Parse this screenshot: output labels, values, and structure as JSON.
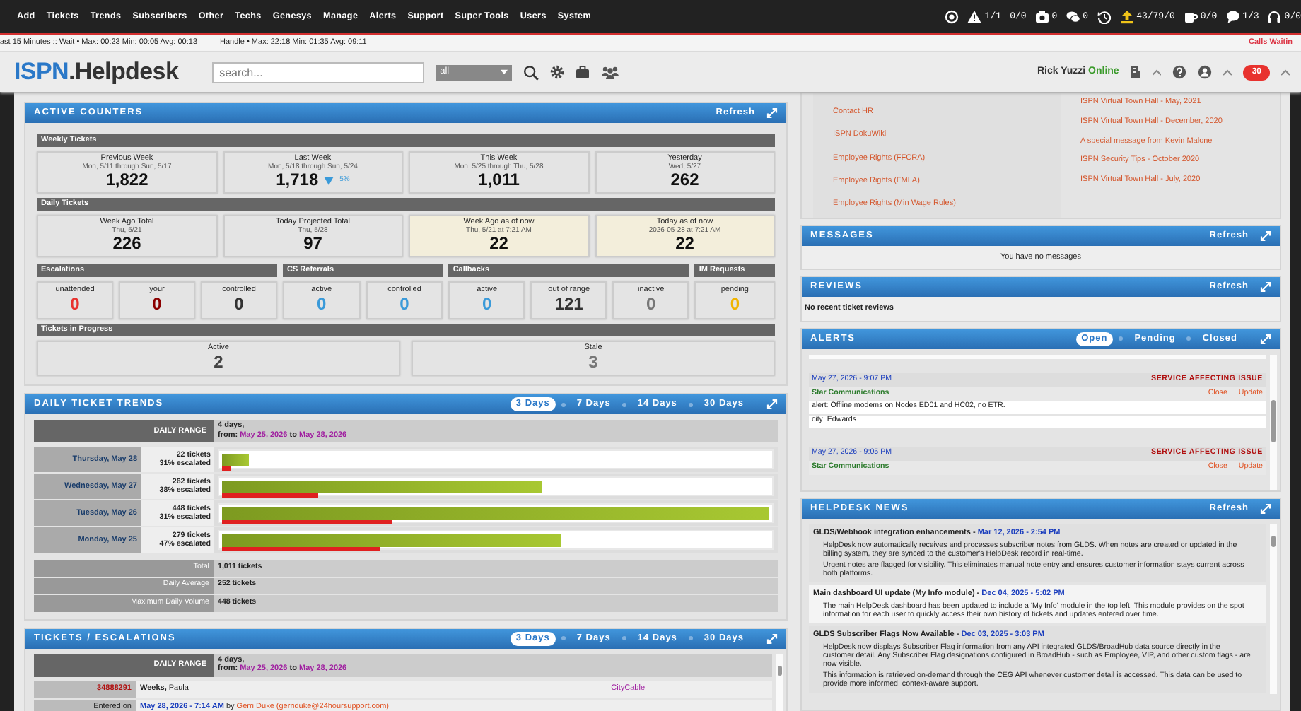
{
  "nav": {
    "menu": [
      "Add",
      "Tickets",
      "Trends",
      "Subscribers",
      "Other",
      "Techs",
      "Genesys",
      "Manage",
      "Alerts",
      "Support",
      "Super Tools",
      "Users",
      "System"
    ],
    "status": [
      {
        "kind": "target"
      },
      {
        "kind": "warning",
        "text": "1/1"
      },
      {
        "kind": "plain",
        "text": "0/0"
      },
      {
        "kind": "camera",
        "text": "0"
      },
      {
        "kind": "chat",
        "text": "0"
      },
      {
        "kind": "history"
      },
      {
        "kind": "upload",
        "text": "43/79/0"
      },
      {
        "kind": "mug",
        "text": "0/0"
      },
      {
        "kind": "comment",
        "text": "1/3"
      },
      {
        "kind": "headset",
        "text": "0/0"
      }
    ]
  },
  "stats_bar": {
    "text": "ast 15 Minutes :: Wait • Max: 00:23 Min: 00:05 Avg: 00:13",
    "handle": "Handle • Max: 22:18 Min: 01:35 Avg: 09:11",
    "right": "Calls Waitin"
  },
  "header": {
    "brand": "ISPN",
    "product": ".Helpdesk",
    "search": {
      "placeholder": "search..."
    },
    "scope": "all",
    "user": "Rick Yuzzi",
    "presence": "Online",
    "notifications": "30"
  },
  "active_counters": {
    "title": "ACTIVE COUNTERS",
    "refresh": "Refresh",
    "weekly": {
      "title": "Weekly Tickets",
      "boxes": [
        {
          "label": "Previous Week",
          "sub": "Mon, 5/11 through Sun, 5/17",
          "value": "1,822",
          "highlighted": false
        },
        {
          "label": "Last Week",
          "sub": "Mon, 5/18 through Sun, 5/24",
          "value": "1,718",
          "highlighted": false,
          "trend": {
            "down": true,
            "text": "5%"
          }
        },
        {
          "label": "This Week",
          "sub": "Mon, 5/25 through Thu, 5/28",
          "value": "1,011",
          "highlighted": false
        },
        {
          "label": "Yesterday",
          "sub": "Wed, 5/27",
          "value": "262",
          "highlighted": false
        }
      ]
    },
    "daily": {
      "title": "Daily Tickets",
      "boxes": [
        {
          "label": "Week Ago Total",
          "sub": "Thu, 5/21",
          "value": "226",
          "highlighted": false
        },
        {
          "label": "Today Projected Total",
          "sub": "Thu, 5/28",
          "value": "97",
          "highlighted": false
        },
        {
          "label": "Week Ago as of now",
          "sub": "Thu, 5/21 at 7:21 AM",
          "value": "22",
          "highlighted": true
        },
        {
          "label": "Today as of now",
          "sub": "2026-05-28 at 7:21 AM",
          "value": "22",
          "highlighted": true
        }
      ]
    },
    "groups": [
      {
        "title": "Escalations",
        "boxes": [
          {
            "label": "unattended",
            "value": "0",
            "color": "#e8322e"
          },
          {
            "label": "your",
            "value": "0",
            "color": "#8b0000"
          },
          {
            "label": "controlled",
            "value": "0",
            "color": "#333333"
          }
        ]
      },
      {
        "title": "CS Referrals",
        "boxes": [
          {
            "label": "active",
            "value": "0",
            "color": "#3a9ad9"
          },
          {
            "label": "controlled",
            "value": "0",
            "color": "#3a9ad9"
          }
        ]
      },
      {
        "title": "Callbacks",
        "boxes": [
          {
            "label": "active",
            "value": "0",
            "color": "#3a9ad9"
          },
          {
            "label": "out of range",
            "value": "121",
            "color": "#333333"
          },
          {
            "label": "inactive",
            "value": "0",
            "color": "#777777"
          }
        ]
      },
      {
        "title": "IM Requests",
        "boxes": [
          {
            "label": "pending",
            "value": "0",
            "color": "#f0b400"
          }
        ]
      }
    ],
    "progress": {
      "title": "Tickets in Progress",
      "boxes": [
        {
          "label": "Active",
          "value": "2",
          "color": "#444444"
        },
        {
          "label": "Stale",
          "value": "3",
          "color": "#777777"
        }
      ]
    }
  },
  "daily_trends": {
    "title": "DAILY TICKET TRENDS",
    "tabs": [
      {
        "label": "3 Days",
        "selected": true
      },
      {
        "label": "7 Days",
        "selected": false
      },
      {
        "label": "14 Days",
        "selected": false
      },
      {
        "label": "30 Days",
        "selected": false
      }
    ],
    "range": {
      "label": "DAILY RANGE",
      "span": "4 days,",
      "from_label": "from:",
      "start": "May 25, 2026",
      "joiner": "to",
      "end": "May 28, 2026"
    },
    "days": [
      {
        "day": "Thursday, May 28",
        "tickets": "22 tickets",
        "escalated": "31% escalated",
        "level": 0.048,
        "escalation": {
          "level": 0.015
        }
      },
      {
        "day": "Wednesday, May 27",
        "tickets": "262 tickets",
        "escalated": "38% escalated",
        "level": 0.585,
        "escalation": {
          "level": 0.176
        }
      },
      {
        "day": "Tuesday, May 26",
        "tickets": "448 tickets",
        "escalated": "31% escalated",
        "level": 1.0,
        "escalation": {
          "level": 0.31
        }
      },
      {
        "day": "Monday, May 25",
        "tickets": "279 tickets",
        "escalated": "47% escalated",
        "level": 0.62,
        "escalation": {
          "level": 0.29
        }
      }
    ],
    "totals": [
      {
        "label": "Total",
        "value": "1,011 tickets"
      },
      {
        "label": "Daily Average",
        "value": "252 tickets"
      },
      {
        "label": "Maximum Daily Volume",
        "value": "448 tickets"
      }
    ]
  },
  "tickets": {
    "title": "TICKETS / ESCALATIONS",
    "tabs": [
      {
        "label": "3 Days",
        "selected": true
      },
      {
        "label": "7 Days",
        "selected": false
      },
      {
        "label": "14 Days",
        "selected": false
      },
      {
        "label": "30 Days",
        "selected": false
      }
    ],
    "range": {
      "label": "DAILY RANGE",
      "span": "4 days,",
      "from_label": "from:",
      "start": "May 25, 2026",
      "joiner": "to",
      "end": "May 28, 2026"
    },
    "ticket": {
      "id": "34888291",
      "last_name": "Weeks,",
      "first_name": "Paula",
      "company": "CityCable",
      "entered_label": "Entered on",
      "entered": "May 28, 2026 - 7:14 AM",
      "by": "by",
      "agent": "Gerri Duke (gerriduke@24hoursupport.com)"
    }
  },
  "links": {
    "left": [
      "Contact HR",
      "ISPN DokuWiki",
      "Employee Rights (FFCRA)",
      "Employee Rights (FMLA)",
      "Employee Rights (Min Wage Rules)"
    ],
    "right": [
      "ISPN Virtual Town Hall - May, 2021",
      "ISPN Virtual Town Hall - December, 2020",
      "A special message from Kevin Malone",
      "ISPN Security Tips - October 2020",
      "ISPN Virtual Town Hall - July, 2020"
    ]
  },
  "messages": {
    "title": "MESSAGES",
    "refresh": "Refresh",
    "empty": "You have no messages"
  },
  "reviews": {
    "title": "REVIEWS",
    "refresh": "Refresh",
    "empty": "No recent ticket reviews"
  },
  "alerts": {
    "title": "ALERTS",
    "tabs": [
      {
        "label": "Open",
        "selected": true
      },
      {
        "label": "Pending",
        "selected": false
      },
      {
        "label": "Closed",
        "selected": false
      }
    ],
    "items": [
      {
        "time": "May 27, 2026 - 9:07 PM",
        "type": "SERVICE AFFECTING ISSUE",
        "company": "Star Communications",
        "actions": [
          "Close",
          "Update"
        ],
        "lines": [
          "alert: Offline modems on Nodes ED01 and HC02, no ETR.",
          "city: Edwards"
        ]
      },
      {
        "time": "May 27, 2026 - 9:05 PM",
        "type": "SERVICE AFFECTING ISSUE",
        "company": "Star Communications",
        "actions": [
          "Close",
          "Update"
        ]
      }
    ]
  },
  "news": {
    "title": "HELPDESK NEWS",
    "refresh": "Refresh",
    "items": [
      {
        "title": "GLDS/Webhook integration enhancements",
        "separator": "-",
        "date": "Mar 12, 2026 - 2:54 PM",
        "paragraphs": [
          "HelpDesk now automatically receives and processes subscriber notes from GLDS. When notes are created or updated in the billing system, they are synced to the customer's HelpDesk record in real-time.",
          "Urgent notes are flagged for visibility. This eliminates manual note entry and ensures customer information stays current across both platforms."
        ]
      },
      {
        "title": "Main dashboard UI update (My Info module)",
        "separator": "-",
        "date": "Dec 04, 2025 - 5:02 PM",
        "paragraphs": [
          "The main HelpDesk dashboard has been updated to include a 'My Info' module in the top left. This module provides on the spot information for each user to quickly access their own history of tickets and updates entered over time."
        ]
      },
      {
        "title": "GLDS Subscriber Flags Now Available",
        "separator": "-",
        "date": "Dec 03, 2025 - 3:03 PM",
        "paragraphs": [
          "HelpDesk now displays Subscriber Flag information from any API integrated GLDS/BroadHub data source directly in the customer detail. Any Subscriber Flag designations configured in BroadHub - such as Employee, VIP, and other custom flags - are now visible.",
          "This information is retrieved on-demand through the CEG API whenever customer detail is accessed. This data can be used to provide more informed, context-aware support."
        ]
      }
    ]
  }
}
